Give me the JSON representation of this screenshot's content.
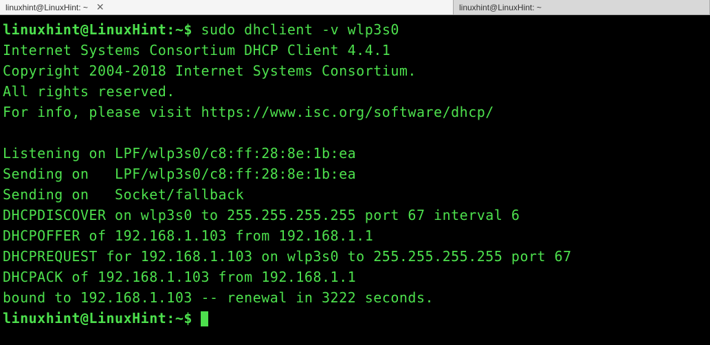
{
  "tabs": [
    {
      "label": "linuxhint@LinuxHint: ~"
    },
    {
      "label": "linuxhint@LinuxHint: ~"
    }
  ],
  "prompt": {
    "user_host": "linuxhint@LinuxHint",
    "path": "~",
    "symbol": "$"
  },
  "command": "sudo dhclient -v wlp3s0",
  "output_lines": [
    "Internet Systems Consortium DHCP Client 4.4.1",
    "Copyright 2004-2018 Internet Systems Consortium.",
    "All rights reserved.",
    "For info, please visit https://www.isc.org/software/dhcp/",
    "",
    "Listening on LPF/wlp3s0/c8:ff:28:8e:1b:ea",
    "Sending on   LPF/wlp3s0/c8:ff:28:8e:1b:ea",
    "Sending on   Socket/fallback",
    "DHCPDISCOVER on wlp3s0 to 255.255.255.255 port 67 interval 6",
    "DHCPOFFER of 192.168.1.103 from 192.168.1.1",
    "DHCPREQUEST for 192.168.1.103 on wlp3s0 to 255.255.255.255 port 67",
    "DHCPACK of 192.168.1.103 from 192.168.1.1",
    "bound to 192.168.1.103 -- renewal in 3222 seconds."
  ]
}
